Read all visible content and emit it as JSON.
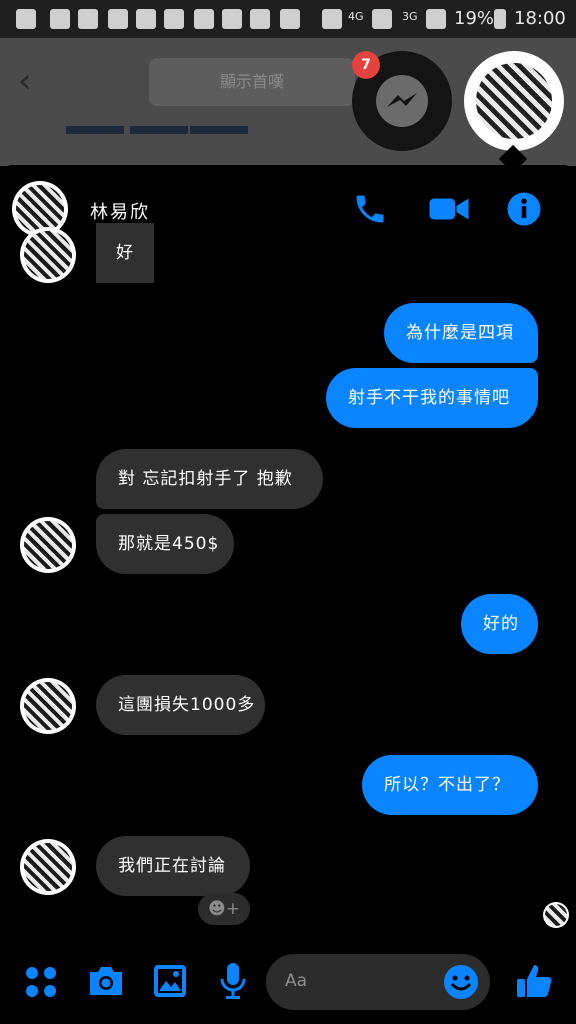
{
  "status_bar": {
    "network_a": "4G",
    "network_b": "3G",
    "battery": "19%",
    "time": "18:00"
  },
  "background_app": {
    "header_button": "顯示首嘆"
  },
  "chat_heads": {
    "unread_count": "7"
  },
  "conversation": {
    "contact_name": "林易欣",
    "messages": [
      {
        "from": "them",
        "text": "好"
      },
      {
        "from": "me",
        "text": "為什麼是四項"
      },
      {
        "from": "me",
        "text": "射手不干我的事情吧"
      },
      {
        "from": "them",
        "text": "對 忘記扣射手了 抱歉"
      },
      {
        "from": "them",
        "text": "那就是450$"
      },
      {
        "from": "me",
        "text": "好的"
      },
      {
        "from": "them",
        "text": "這團損失1000多"
      },
      {
        "from": "me",
        "text": "所以？不出了？"
      },
      {
        "from": "them",
        "text": "我們正在討論"
      }
    ]
  },
  "composer": {
    "placeholder": "Aa"
  },
  "colors": {
    "accent": "#0a84ff",
    "incoming_bubble": "#303030",
    "background": "#000000",
    "badge": "#e4423f"
  }
}
